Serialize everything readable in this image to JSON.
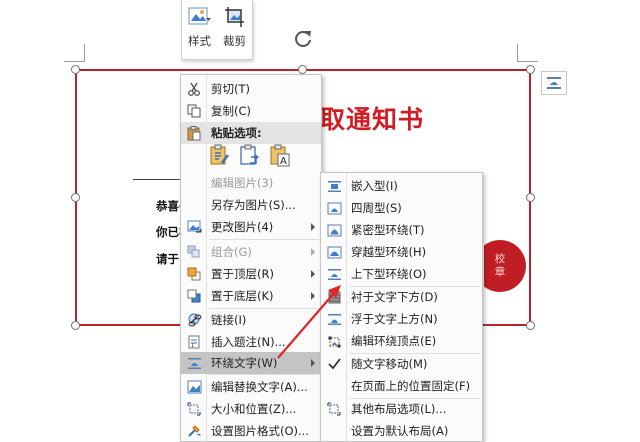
{
  "mini_toolbar": {
    "style_label": "样式",
    "crop_label": "裁剪"
  },
  "document": {
    "title": "取通知书",
    "line1": "恭喜亻",
    "line2": "你已初",
    "line3": "请于",
    "seal_line1": "校",
    "seal_line2": "章"
  },
  "context_menu": {
    "items": [
      {
        "label": "剪切(T)",
        "icon": "scissors-icon"
      },
      {
        "label": "复制(C)",
        "icon": "copy-icon"
      },
      {
        "label": "粘贴选项:",
        "icon": "paste-icon"
      },
      {
        "label": "编辑图片(3)",
        "icon": ""
      },
      {
        "label": "另存为图片(S)...",
        "icon": ""
      },
      {
        "label": "更改图片(4)",
        "icon": "change-picture-icon"
      },
      {
        "label": "组合(G)",
        "icon": "group-icon"
      },
      {
        "label": "置于顶层(R)",
        "icon": "bring-front-icon"
      },
      {
        "label": "置于底层(K)",
        "icon": "send-back-icon"
      },
      {
        "label": "链接(I)",
        "icon": "link-icon"
      },
      {
        "label": "插入题注(N)...",
        "icon": "caption-icon"
      },
      {
        "label": "环绕文字(W)",
        "icon": "wrap-text-icon"
      },
      {
        "label": "编辑替换文字(A)...",
        "icon": "alt-text-icon"
      },
      {
        "label": "大小和位置(Z)...",
        "icon": "size-position-icon"
      },
      {
        "label": "设置图片格式(O)...",
        "icon": "format-picture-icon"
      }
    ]
  },
  "wrap_submenu": {
    "items": [
      {
        "label": "嵌入型(I)"
      },
      {
        "label": "四周型(S)"
      },
      {
        "label": "紧密型环绕(T)"
      },
      {
        "label": "穿越型环绕(H)"
      },
      {
        "label": "上下型环绕(O)"
      },
      {
        "label": "衬于文字下方(D)"
      },
      {
        "label": "浮于文字上方(N)"
      },
      {
        "label": "编辑环绕顶点(E)"
      },
      {
        "label": "随文字移动(M)"
      },
      {
        "label": "在页面上的位置固定(F)"
      },
      {
        "label": "其他布局选项(L)..."
      },
      {
        "label": "设置为默认布局(A)"
      }
    ]
  },
  "colors": {
    "accent_red": "#d21c24",
    "annotation_red": "#e0252b"
  }
}
